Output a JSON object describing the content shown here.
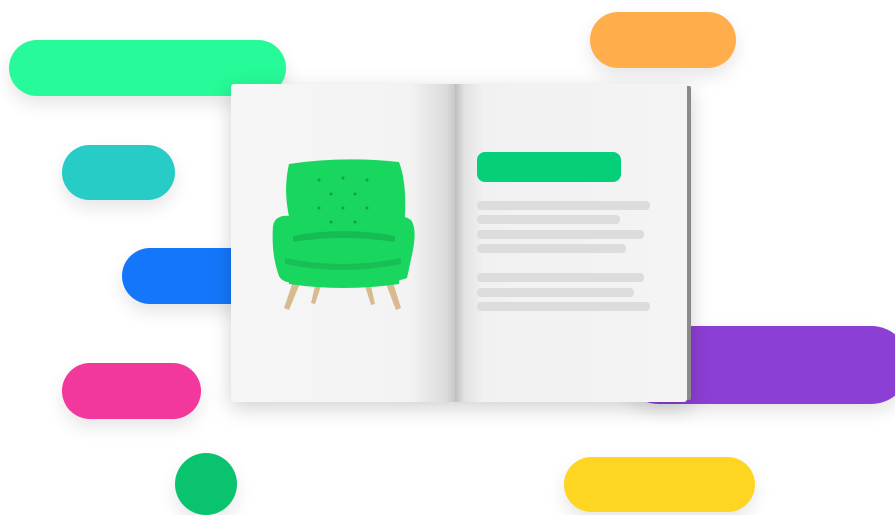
{
  "colors": {
    "pill_green_top": "#27fa98",
    "pill_orange": "#ffae4b",
    "pill_teal": "#27ccc6",
    "pill_blue": "#1477fb",
    "pill_purple": "#8b3fd4",
    "pill_pink": "#f2389c",
    "pill_yellow": "#fed521",
    "dot_green": "#0ac36f",
    "heading_bar": "#06cf7a",
    "chair": "#19d65f",
    "text_placeholder": "#dcdcdc"
  },
  "catalog": {
    "left_page_image": "green-armchair",
    "right_page": {
      "heading_placeholder": true,
      "paragraph_count": 2
    }
  }
}
